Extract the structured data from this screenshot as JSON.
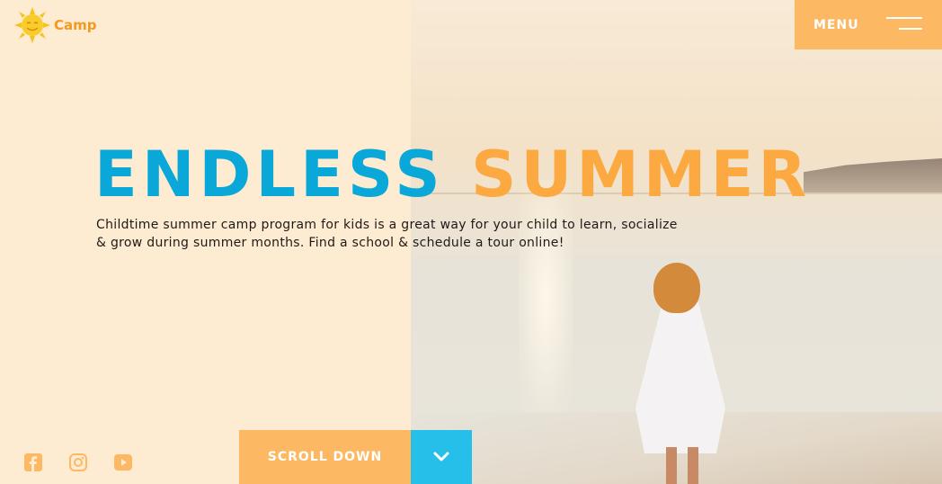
{
  "brand": {
    "logo_text": "Camp"
  },
  "header": {
    "menu_label": "MENU"
  },
  "hero": {
    "headline_word1": "ENDLESS",
    "headline_word2": "SUMMER",
    "subtitle": "Childtime summer camp program for kids is a great way for your child to learn, socialize & grow during summer months. Find a school & schedule a tour online!"
  },
  "cta": {
    "scroll_label": "SCROLL DOWN"
  },
  "social": [
    "facebook-icon",
    "instagram-icon",
    "youtube-icon"
  ],
  "colors": {
    "accent_blue": "#0aa8d8",
    "accent_orange": "#fda941",
    "button_orange": "#fdb863",
    "button_blue": "#25bfea",
    "panel_bg": "#fdebd2"
  }
}
